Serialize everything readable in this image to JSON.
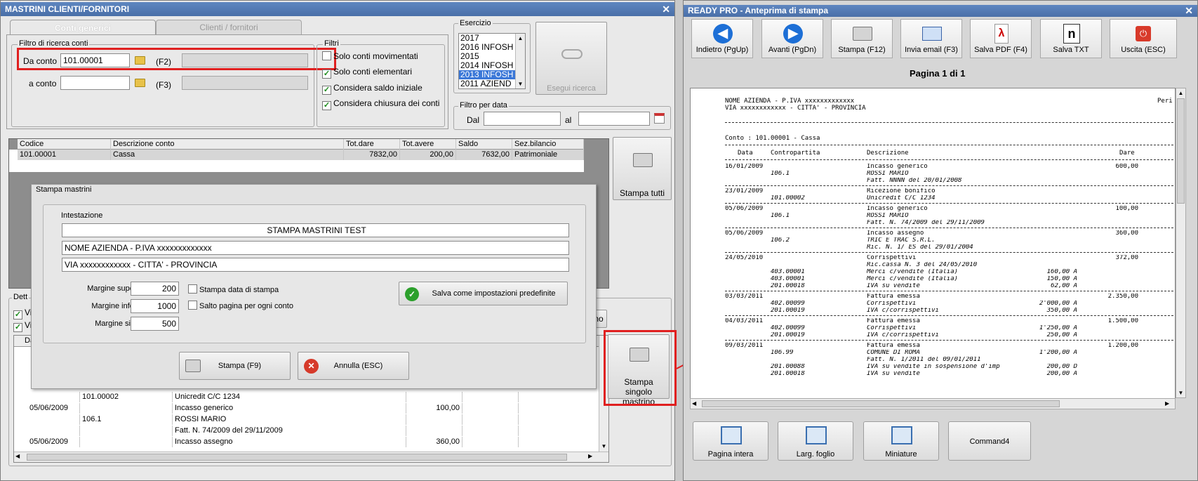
{
  "left_window": {
    "title": "MASTRINI CLIENTI/FORNITORI",
    "tabs": [
      "Conti generici",
      "Clienti / fornitori"
    ],
    "filter_group_title": "Filtro di ricerca conti",
    "from_label": "Da conto",
    "from_value": "101.00001",
    "from_key": "(F2)",
    "to_label": "a conto",
    "to_value": "",
    "to_key": "(F3)",
    "filters_title": "Filtri",
    "filters": [
      {
        "label": "Solo conti movimentati",
        "checked": false
      },
      {
        "label": "Solo conti elementari",
        "checked": true
      },
      {
        "label": "Considera saldo iniziale",
        "checked": true
      },
      {
        "label": "Considera chiusura dei conti",
        "checked": true
      }
    ],
    "esercizio_title": "Esercizio",
    "esercizio_items": [
      "2017",
      "2016 INFOSH",
      "2015",
      "2014 INFOSH",
      "2013 INFOSH",
      "2011 AZIEND"
    ],
    "search_button": "Esegui ricerca",
    "date_filter_title": "Filtro per data",
    "dal_label": "Dal",
    "al_label": "al",
    "grid_headers": [
      "Codice",
      "Descrizione conto",
      "Tot.dare",
      "Tot.avere",
      "Saldo",
      "Sez.bilancio"
    ],
    "grid_row": [
      "101.00001",
      "Cassa",
      "7832,00",
      "200,00",
      "7632,00",
      "Patrimoniale"
    ],
    "print_all_button": "Stampa tutti",
    "print_single_button": "Stampa singolo mastrino",
    "detail_title": "Dett",
    "detail_checks": [
      "Vis",
      "Vis"
    ],
    "detail_header_first": "Da",
    "detail_header_fragment": "no",
    "detail_rows": [
      [
        "",
        "101.00002",
        "Unicredit C/C 1234",
        "",
        ""
      ],
      [
        "05/06/2009",
        "",
        "Incasso generico",
        "100,00",
        ""
      ],
      [
        "",
        "106.1",
        "ROSSI MARIO",
        "",
        ""
      ],
      [
        "",
        "",
        "Fatt. N. 74/2009 del 29/11/2009",
        "",
        ""
      ],
      [
        "05/06/2009",
        "",
        "Incasso assegno",
        "360,00",
        ""
      ]
    ]
  },
  "dialog": {
    "title": "Stampa mastrini",
    "header_title": "Intestazione",
    "header_lines": [
      "STAMPA MASTRINI TEST",
      "NOME AZIENDA - P.IVA xxxxxxxxxxxxx",
      "VIA xxxxxxxxxxxx - CITTA' - PROVINCIA"
    ],
    "margin_top_label": "Margine superiore :",
    "margin_top": "200",
    "margin_bottom_label": "Margine inferiore :",
    "margin_bottom": "1000",
    "margin_left_label": "Margine sinistro :",
    "margin_left": "500",
    "print_date_label": "Stampa data di stampa",
    "page_break_label": "Salto pagina per ogni conto",
    "save_defaults_button": "Salva come impostazioni predefinite",
    "print_button": "Stampa (F9)",
    "cancel_button": "Annulla (ESC)"
  },
  "right_window": {
    "title": "READY PRO - Anteprima di stampa",
    "toolbar": [
      "Indietro (PgUp)",
      "Avanti (PgDn)",
      "Stampa (F12)",
      "Invia email (F3)",
      "Salva PDF (F4)",
      "Salva TXT",
      "Uscita (ESC)"
    ],
    "page_label": "Pagina 1 di 1",
    "bottom_buttons": [
      "Pagina intera",
      "Larg. foglio",
      "Miniature",
      "Command4"
    ]
  },
  "preview": {
    "company_line": "NOME AZIENDA - P.IVA xxxxxxxxxxxxx",
    "period_fragment": "Peri",
    "address_line": "VIA xxxxxxxxxxxx - CITTA' - PROVINCIA",
    "account_line": "Conto : 101.00001 - Cassa",
    "col_headers": [
      "Data",
      "Contropartita",
      "Descrizione",
      "Dare"
    ],
    "entries": [
      [
        "16/01/2009",
        "",
        "Incasso generico",
        "",
        "600,00"
      ],
      [
        "",
        "106.1",
        "ROSSI MARIO",
        "",
        ""
      ],
      [
        "",
        "",
        "Fatt. NNNN del 20/01/2008",
        "",
        ""
      ],
      [
        "23/01/2009",
        "",
        "Ricezione bonifico",
        "",
        ""
      ],
      [
        "",
        "101.00002",
        "Unicredit C/C 1234",
        "",
        ""
      ],
      [
        "05/06/2009",
        "",
        "Incasso generico",
        "",
        "100,00"
      ],
      [
        "",
        "106.1",
        "ROSSI MARIO",
        "",
        ""
      ],
      [
        "",
        "",
        "Fatt. N. 74/2009 del 29/11/2009",
        "",
        ""
      ],
      [
        "05/06/2009",
        "",
        "Incasso assegno",
        "",
        "360,00"
      ],
      [
        "",
        "106.2",
        "TRIC E TRAC S.R.L.",
        "",
        ""
      ],
      [
        "",
        "",
        "Ric. N. 1/ ES del 29/01/2004",
        "",
        ""
      ],
      [
        "24/05/2010",
        "",
        "Corrispettivi",
        "",
        "372,00"
      ],
      [
        "",
        "",
        "Ric.cassa N. 3 del 24/05/2010",
        "",
        ""
      ],
      [
        "",
        "403.00001",
        "Merci c/vendite (Italia)",
        "160,00 A",
        ""
      ],
      [
        "",
        "403.00001",
        "Merci c/vendite (Italia)",
        "150,00 A",
        ""
      ],
      [
        "",
        "201.00018",
        "IVA su vendite",
        "62,00 A",
        ""
      ],
      [
        "03/03/2011",
        "",
        "Fattura emessa",
        "",
        "2.350,00"
      ],
      [
        "",
        "402.00099",
        "Corrispettivi",
        "2'000,00 A",
        ""
      ],
      [
        "",
        "201.00019",
        "IVA c/corrispettivi",
        "350,00 A",
        ""
      ],
      [
        "04/03/2011",
        "",
        "Fattura emessa",
        "",
        "1.500,00"
      ],
      [
        "",
        "402.00099",
        "Corrispettivi",
        "1'250,00 A",
        ""
      ],
      [
        "",
        "201.00019",
        "IVA c/corrispettivi",
        "250,00 A",
        ""
      ],
      [
        "09/03/2011",
        "",
        "Fattura emessa",
        "",
        "1.200,00"
      ],
      [
        "",
        "106.99",
        "COMUNE DI ROMA",
        "1'200,00 A",
        ""
      ],
      [
        "",
        "",
        "Fatt. N. 1/2011 del 09/01/2011",
        "",
        ""
      ],
      [
        "",
        "201.00088",
        "IVA su vendite in sospensione d'imp",
        "200,00 D",
        ""
      ],
      [
        "",
        "201.00018",
        "IVA su vendite",
        "200,00 A",
        ""
      ]
    ]
  },
  "colors": {
    "titlebar": "#4a6fa8",
    "highlight": "#e02020",
    "selection": "#3b78d8"
  }
}
